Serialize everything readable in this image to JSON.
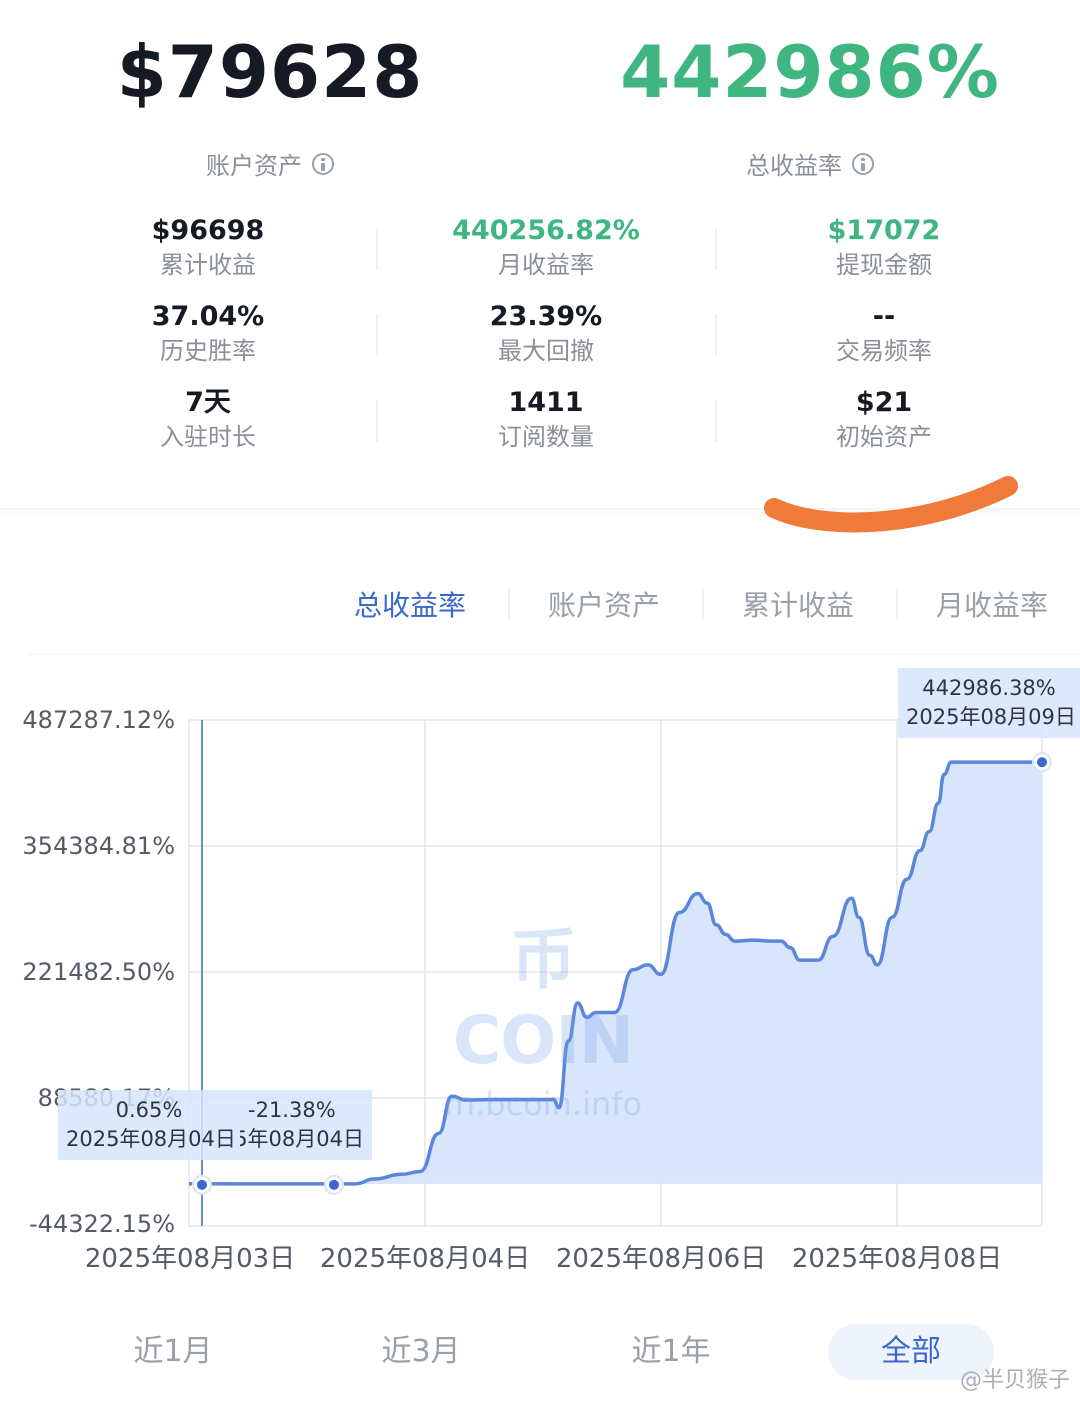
{
  "summary": {
    "account_asset_value": "$79628",
    "account_asset_label": "账户资产",
    "total_return_value": "442986%",
    "total_return_label": "总收益率"
  },
  "stats": [
    [
      {
        "value": "$96698",
        "label": "累计收益",
        "color": "dark"
      },
      {
        "value": "440256.82%",
        "label": "月收益率",
        "color": "green"
      },
      {
        "value": "$17072",
        "label": "提现金额",
        "color": "green"
      }
    ],
    [
      {
        "value": "37.04%",
        "label": "历史胜率",
        "color": "dark"
      },
      {
        "value": "23.39%",
        "label": "最大回撤",
        "color": "dark"
      },
      {
        "value": "--",
        "label": "交易频率",
        "color": "dark"
      }
    ],
    [
      {
        "value": "7天",
        "label": "入驻时长",
        "color": "dark"
      },
      {
        "value": "1411",
        "label": "订阅数量",
        "color": "dark"
      },
      {
        "value": "$21",
        "label": "初始资产",
        "color": "dark"
      }
    ]
  ],
  "tabs": [
    {
      "label": "总收益率",
      "active": true
    },
    {
      "label": "账户资产",
      "active": false
    },
    {
      "label": "累计收益",
      "active": false
    },
    {
      "label": "月收益率",
      "active": false
    }
  ],
  "chart_data": {
    "type": "area",
    "y_ticks": [
      "487287.12%",
      "354384.81%",
      "221482.50%",
      "88580.17%",
      "-44322.15%"
    ],
    "ylim": [
      -44322.15,
      487287.12
    ],
    "x_ticks": [
      "2025年08月03日",
      "2025年08月04日",
      "2025年08月06日",
      "2025年08月08日"
    ],
    "grid": true,
    "x": [
      0,
      0.55,
      0.9,
      1.0,
      1.15,
      1.25,
      1.35,
      1.42,
      1.5,
      1.62,
      1.75,
      1.85,
      1.97,
      2.0,
      2.05,
      2.1,
      2.15,
      2.2,
      2.3,
      2.4,
      2.48,
      2.55,
      2.65,
      2.75,
      2.8,
      2.85,
      2.9,
      2.95,
      3.05,
      3.15,
      3.2,
      3.25,
      3.3,
      3.4,
      3.48,
      3.58,
      3.62,
      3.68,
      3.72,
      3.8,
      3.88,
      3.95,
      4.0,
      4.05,
      4.08,
      4.12,
      4.18,
      4.25,
      4.3,
      4.36,
      4.4,
      4.47,
      4.53,
      4.57,
      4.61
    ],
    "values": [
      0.65,
      -21.38,
      0,
      5000,
      10000,
      13000,
      53000,
      92000,
      88000,
      88500,
      88500,
      88500,
      88500,
      80000,
      150000,
      190000,
      175000,
      180000,
      180000,
      225000,
      230000,
      220000,
      285000,
      305000,
      295000,
      272000,
      262000,
      255000,
      256000,
      255000,
      255000,
      248000,
      235000,
      235000,
      260000,
      300000,
      280000,
      240000,
      230000,
      280000,
      320000,
      350000,
      370000,
      400000,
      430000,
      442986.38,
      442986.38,
      442986.38,
      442986.38,
      442986.38,
      442986.38,
      442986.38,
      442986.38,
      442986.38,
      442986.38
    ],
    "tooltips": [
      {
        "value": "0.65%",
        "date": "2025年08月04日"
      },
      {
        "value": "-21.38%",
        "date": "2025年08月04日"
      },
      {
        "value": "442986.38%",
        "date": "2025年08月09日"
      }
    ],
    "line_color": "#5a86dc",
    "fill_color": "#d6e4fb"
  },
  "watermark": {
    "logo": "币COIN",
    "url": "m.bcoin.info"
  },
  "ranges": [
    {
      "label": "近1月",
      "active": false
    },
    {
      "label": "近3月",
      "active": false
    },
    {
      "label": "近1年",
      "active": false
    },
    {
      "label": "全部",
      "active": true
    }
  ],
  "credit": "@半贝猴子",
  "colors": {
    "accent": "#3b68ce",
    "green": "#3fb57f",
    "annotation": "#f07a3a"
  }
}
